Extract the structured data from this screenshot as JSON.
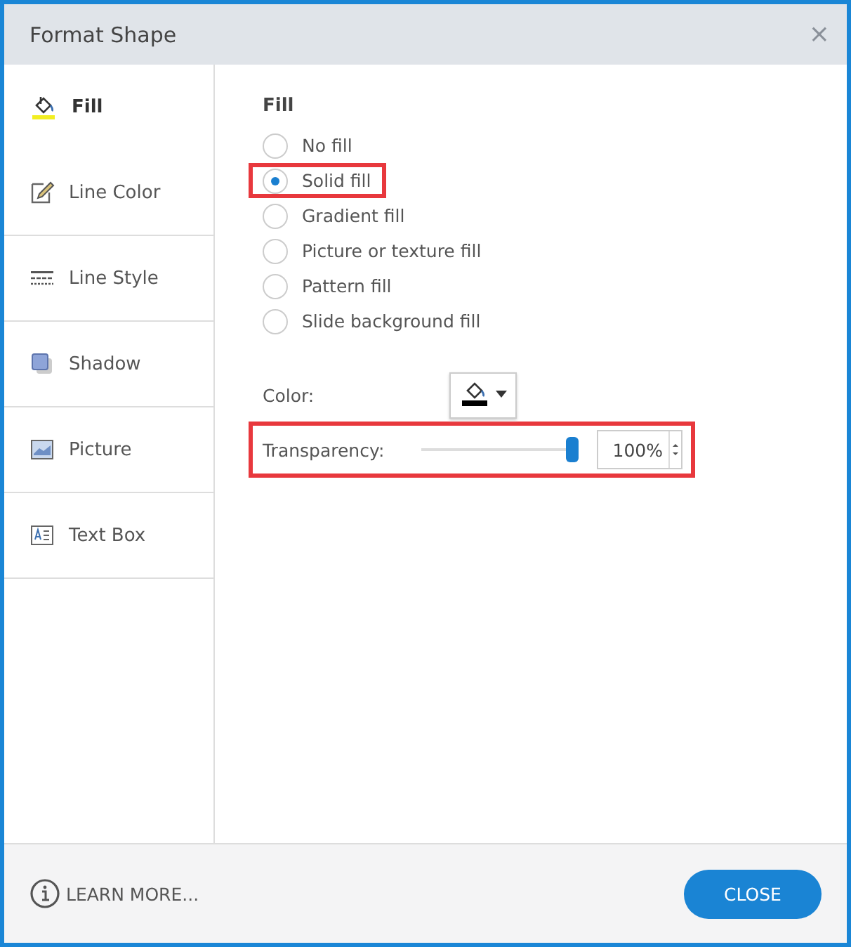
{
  "window": {
    "title": "Format Shape",
    "close": "×"
  },
  "sidebar": {
    "items": [
      {
        "label": "Fill",
        "kind": "fill",
        "selected": true
      },
      {
        "label": "Line Color",
        "kind": "line-color",
        "selected": false
      },
      {
        "label": "Line Style",
        "kind": "line-style",
        "selected": false
      },
      {
        "label": "Shadow",
        "kind": "shadow",
        "selected": false
      },
      {
        "label": "Picture",
        "kind": "picture",
        "selected": false
      },
      {
        "label": "Text Box",
        "kind": "text-box",
        "selected": false
      }
    ]
  },
  "fill": {
    "heading": "Fill",
    "options": [
      {
        "label": "No fill",
        "selected": false,
        "highlighted": false
      },
      {
        "label": "Solid fill",
        "selected": true,
        "highlighted": true
      },
      {
        "label": "Gradient fill",
        "selected": false,
        "highlighted": false
      },
      {
        "label": "Picture or texture fill",
        "selected": false,
        "highlighted": false
      },
      {
        "label": "Pattern fill",
        "selected": false,
        "highlighted": false
      },
      {
        "label": "Slide background fill",
        "selected": false,
        "highlighted": false
      }
    ],
    "color_label": "Color:",
    "transparency": {
      "label": "Transparency:",
      "level": 1,
      "value": "100%",
      "highlighted": true
    }
  },
  "footer": {
    "learn_more": "LEARN MORE...",
    "close_button": "CLOSE"
  }
}
